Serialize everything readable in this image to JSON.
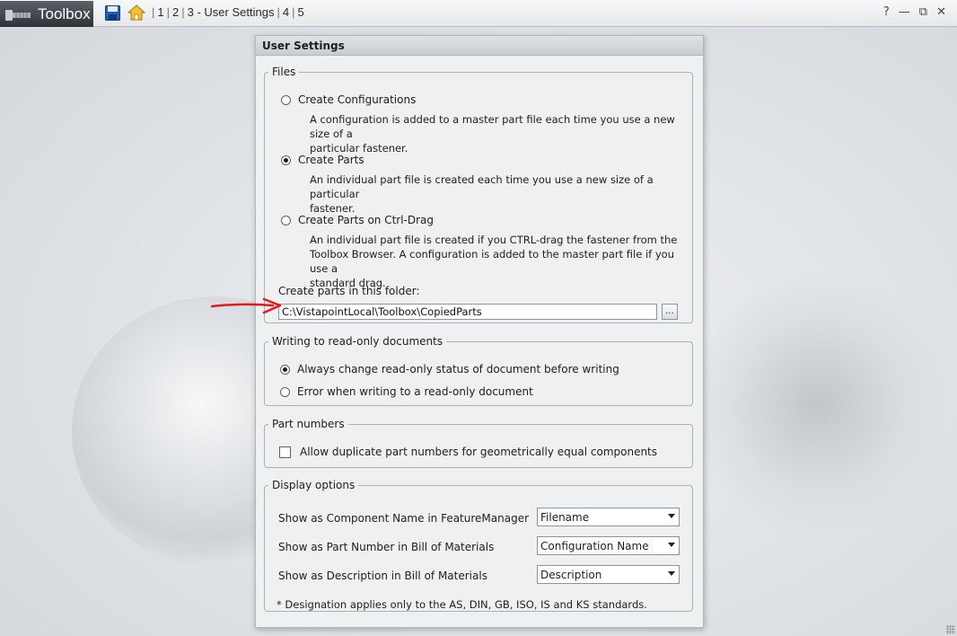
{
  "topbar": {
    "brand": "Toolbox",
    "crumbs": [
      "1",
      "2",
      "3 - User Settings",
      "4",
      "5"
    ],
    "window_buttons": [
      "?",
      "—",
      "⧉",
      "✕"
    ]
  },
  "panel": {
    "title": "User Settings",
    "files": {
      "legend": "Files",
      "options": [
        {
          "label": "Create Configurations",
          "selected": false,
          "desc": [
            "A configuration is added to a master part file each time you use a new size of a",
            "particular fastener."
          ]
        },
        {
          "label": "Create Parts",
          "selected": true,
          "desc": [
            "An individual part file is created each time you use a new size of a particular",
            "fastener."
          ]
        },
        {
          "label": "Create Parts on Ctrl-Drag",
          "selected": false,
          "desc": [
            "An individual part file is created if you CTRL-drag the fastener from the",
            "Toolbox Browser. A configuration is added to the master part file if you use a",
            "standard drag."
          ]
        }
      ],
      "folder_label": "Create parts in this folder:",
      "folder_value": "C:\\VistapointLocal\\Toolbox\\CopiedParts",
      "browse_label": "..."
    },
    "readonly": {
      "legend": "Writing to read-only documents",
      "options": [
        {
          "label": "Always change read-only status of document before writing",
          "selected": true
        },
        {
          "label": "Error when writing to a read-only document",
          "selected": false
        }
      ]
    },
    "part_numbers": {
      "legend": "Part numbers",
      "checkbox_label": "Allow duplicate part numbers for geometrically equal components",
      "checked": false
    },
    "display": {
      "legend": "Display options",
      "rows": [
        {
          "label": "Show as Component Name in FeatureManager",
          "value": "Filename"
        },
        {
          "label": "Show as Part Number in Bill of Materials",
          "value": "Configuration Name"
        },
        {
          "label": "Show as Description in Bill of Materials",
          "value": "Description"
        }
      ],
      "note": "* Designation applies only to the AS, DIN, GB, ISO, IS and KS standards."
    }
  },
  "colors": {
    "annotation_arrow": "#e01b1b",
    "brand_bg": "#3a3f45",
    "home_icon": "#d8a21c",
    "save_icon": "#1f5fb8"
  }
}
